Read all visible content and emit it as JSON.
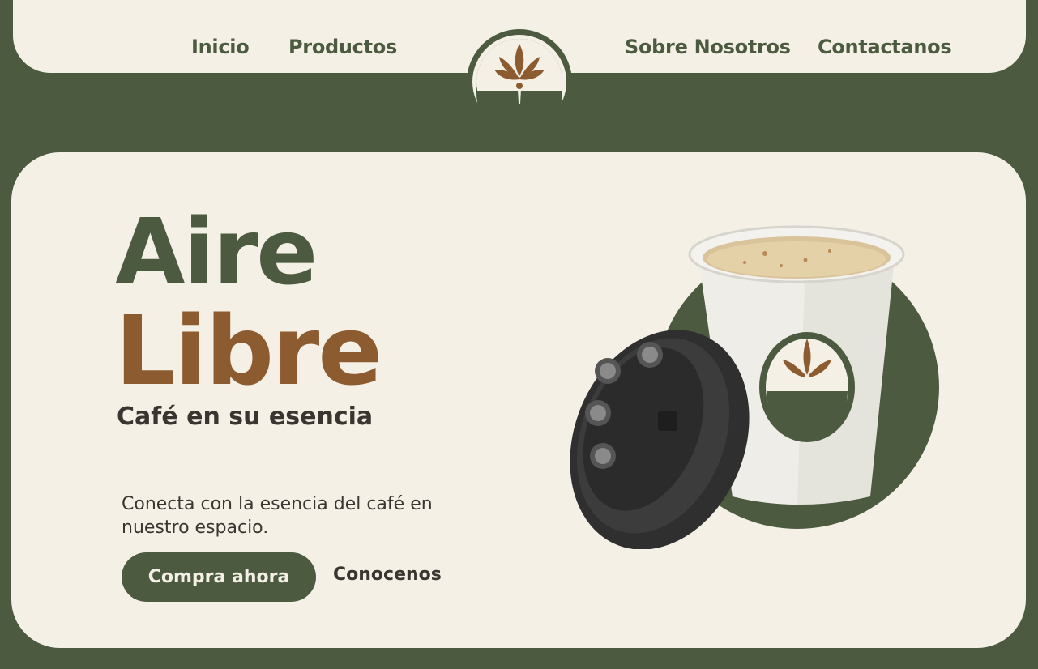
{
  "nav": {
    "links": [
      "Inicio",
      "Productos",
      "Sobre Nosotros",
      "Contactanos"
    ]
  },
  "hero": {
    "title_line1": "Aire",
    "title_line2": "Libre",
    "subtitle": "Café en su esencia",
    "description": "Conecta con la esencia del café en nuestro espacio.",
    "primary_button": "Compra ahora",
    "secondary_button": "Conocenos"
  },
  "colors": {
    "green": "#4c5b3f",
    "brown": "#8d5b30",
    "cream": "#f4f0e6",
    "text_dark": "#3a3530"
  },
  "icons": {
    "logo": "leaf-sprout-icon",
    "product": "coffee-cup-with-lid"
  }
}
